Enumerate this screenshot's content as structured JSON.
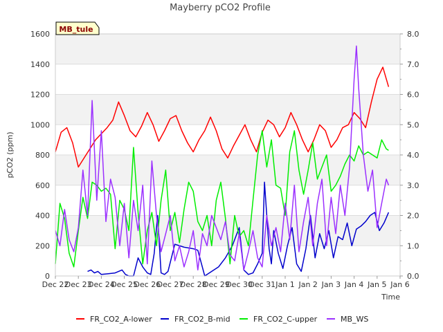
{
  "chart_data": {
    "type": "line",
    "title": "Mayberry pCO2 Profile",
    "xlabel": "Time",
    "ylabel": "pCO2 (ppm)",
    "y2label": "",
    "site_badge": "MB_tule",
    "xlim": [
      0,
      15
    ],
    "x_ticks": [
      "Dec 22",
      "Dec 23",
      "Dec 24",
      "Dec 25",
      "Dec 26",
      "Dec 27",
      "Dec 28",
      "Dec 29",
      "Dec 30",
      "Dec 31",
      "Jan 1",
      "Jan 2",
      "Jan 3",
      "Jan 4",
      "Jan 5",
      "Jan 6"
    ],
    "ylim": [
      0,
      1600
    ],
    "y_ticks": [
      0,
      200,
      400,
      600,
      800,
      1000,
      1200,
      1400,
      1600
    ],
    "y2lim": [
      0,
      8
    ],
    "y2_ticks": [
      "0.0",
      "1.0",
      "2.0",
      "3.0",
      "4.0",
      "5.0",
      "6.0",
      "7.0",
      "8.0"
    ],
    "background_bands": "alternating light grey every 200 ppm",
    "legend_position": "bottom",
    "series": [
      {
        "name": "FR_CO2_A-lower",
        "color": "#ff0000",
        "axis": "left",
        "x": [
          0.0,
          0.25,
          0.5,
          0.75,
          1.0,
          1.25,
          1.5,
          1.75,
          2.0,
          2.25,
          2.5,
          2.75,
          3.0,
          3.25,
          3.5,
          3.75,
          4.0,
          4.25,
          4.5,
          4.75,
          5.0,
          5.25,
          5.5,
          5.75,
          6.0,
          6.25,
          6.5,
          6.75,
          7.0,
          7.25,
          7.5,
          7.75,
          8.0,
          8.25,
          8.5,
          8.75,
          9.0,
          9.25,
          9.5,
          9.75,
          10.0,
          10.25,
          10.5,
          10.75,
          11.0,
          11.25,
          11.5,
          11.75,
          12.0,
          12.25,
          12.5,
          12.75,
          13.0,
          13.25,
          13.5,
          13.75,
          14.0,
          14.25,
          14.5
        ],
        "values": [
          820,
          950,
          980,
          880,
          720,
          780,
          840,
          900,
          940,
          980,
          1030,
          1150,
          1060,
          960,
          920,
          990,
          1080,
          1000,
          890,
          960,
          1040,
          1060,
          960,
          880,
          820,
          900,
          960,
          1050,
          960,
          840,
          780,
          860,
          930,
          1000,
          900,
          820,
          950,
          1030,
          1000,
          920,
          980,
          1080,
          1000,
          900,
          820,
          900,
          1000,
          960,
          850,
          900,
          980,
          1000,
          1080,
          1040,
          980,
          1150,
          1300,
          1380,
          1250
        ]
      },
      {
        "name": "FR_CO2_B-mid",
        "color": "#0000cc",
        "axis": "left",
        "x": [
          1.4,
          1.55,
          1.7,
          1.85,
          2.0,
          2.3,
          2.6,
          2.9,
          3.05,
          3.2,
          3.4,
          3.6,
          3.8,
          4.0,
          4.15,
          4.3,
          4.45,
          4.6,
          4.75,
          4.9,
          5.2,
          5.6,
          6.0,
          6.2,
          6.5,
          6.8,
          7.1,
          7.4,
          7.7,
          8.0,
          8.2,
          8.4,
          8.6,
          8.8,
          9.0,
          9.1,
          9.2,
          9.3,
          9.4,
          9.5,
          9.7,
          9.9,
          10.1,
          10.3,
          10.5,
          10.7,
          10.9,
          11.1,
          11.3,
          11.5,
          11.7,
          11.9,
          12.1,
          12.3,
          12.5,
          12.7,
          12.9,
          13.1,
          13.3,
          13.5,
          13.7,
          13.9,
          14.1,
          14.3,
          14.5
        ],
        "values": [
          30,
          40,
          20,
          30,
          10,
          15,
          20,
          40,
          10,
          0,
          0,
          120,
          60,
          20,
          10,
          150,
          400,
          20,
          10,
          30,
          210,
          190,
          180,
          170,
          0,
          30,
          60,
          120,
          200,
          320,
          40,
          10,
          20,
          80,
          150,
          620,
          400,
          180,
          80,
          300,
          150,
          50,
          200,
          320,
          80,
          30,
          180,
          400,
          120,
          280,
          180,
          300,
          120,
          260,
          240,
          350,
          200,
          310,
          330,
          360,
          400,
          420,
          300,
          350,
          420
        ]
      },
      {
        "name": "FR_CO2_C-upper",
        "color": "#00ee00",
        "axis": "left",
        "x": [
          0.0,
          0.2,
          0.4,
          0.6,
          0.8,
          1.0,
          1.2,
          1.4,
          1.6,
          1.8,
          2.0,
          2.2,
          2.4,
          2.6,
          2.8,
          3.0,
          3.2,
          3.4,
          3.6,
          3.8,
          4.0,
          4.2,
          4.4,
          4.6,
          4.8,
          5.0,
          5.2,
          5.4,
          5.6,
          5.8,
          6.0,
          6.2,
          6.4,
          6.6,
          6.8,
          7.0,
          7.2,
          7.4,
          7.6,
          7.8,
          8.0,
          8.2,
          8.4,
          8.6,
          8.8,
          9.0,
          9.2,
          9.4,
          9.6,
          9.8,
          10.0,
          10.2,
          10.4,
          10.6,
          10.8,
          11.0,
          11.2,
          11.4,
          11.6,
          11.8,
          12.0,
          12.2,
          12.4,
          12.6,
          12.8,
          13.0,
          13.2,
          13.4,
          13.6,
          13.8,
          14.0,
          14.2,
          14.4,
          14.5
        ],
        "values": [
          80,
          480,
          380,
          150,
          60,
          300,
          520,
          380,
          620,
          600,
          560,
          580,
          540,
          180,
          500,
          440,
          300,
          850,
          420,
          80,
          300,
          420,
          200,
          500,
          700,
          300,
          420,
          220,
          440,
          620,
          560,
          360,
          300,
          400,
          200,
          500,
          620,
          380,
          80,
          400,
          260,
          300,
          200,
          500,
          800,
          960,
          720,
          900,
          600,
          580,
          400,
          820,
          960,
          700,
          540,
          700,
          880,
          640,
          720,
          800,
          560,
          600,
          660,
          740,
          800,
          760,
          860,
          800,
          820,
          800,
          780,
          900,
          840,
          830
        ]
      },
      {
        "name": "MB_WS",
        "color": "#9b30ff",
        "axis": "right",
        "x": [
          0.0,
          0.2,
          0.4,
          0.6,
          0.8,
          1.0,
          1.2,
          1.4,
          1.6,
          1.8,
          2.0,
          2.2,
          2.4,
          2.6,
          2.8,
          3.0,
          3.2,
          3.4,
          3.6,
          3.8,
          4.0,
          4.2,
          4.4,
          4.6,
          4.8,
          5.0,
          5.2,
          5.4,
          5.6,
          5.8,
          6.0,
          6.2,
          6.4,
          6.6,
          6.8,
          7.0,
          7.2,
          7.4,
          7.6,
          7.8,
          8.0,
          8.2,
          8.4,
          8.6,
          8.8,
          9.0,
          9.2,
          9.4,
          9.6,
          9.8,
          10.0,
          10.2,
          10.4,
          10.6,
          10.8,
          11.0,
          11.2,
          11.4,
          11.6,
          11.8,
          12.0,
          12.2,
          12.4,
          12.6,
          12.8,
          13.0,
          13.1,
          13.2,
          13.4,
          13.6,
          13.8,
          14.0,
          14.2,
          14.4,
          14.5
        ],
        "values": [
          1.5,
          1.0,
          2.2,
          1.2,
          0.8,
          1.6,
          3.5,
          2.0,
          5.8,
          2.5,
          4.8,
          1.8,
          3.2,
          2.6,
          1.0,
          2.4,
          0.6,
          2.5,
          1.5,
          3.0,
          0.4,
          3.8,
          2.0,
          0.8,
          1.4,
          2.0,
          0.5,
          1.0,
          0.3,
          0.8,
          1.5,
          0.2,
          1.4,
          1.0,
          2.0,
          1.6,
          1.2,
          1.8,
          0.7,
          0.5,
          1.4,
          0.2,
          0.8,
          1.5,
          0.6,
          0.3,
          2.0,
          1.0,
          1.6,
          0.8,
          2.4,
          1.2,
          3.0,
          0.8,
          1.8,
          2.6,
          1.0,
          2.4,
          3.2,
          1.0,
          2.6,
          1.4,
          3.0,
          2.0,
          3.6,
          6.5,
          7.6,
          6.2,
          4.0,
          2.8,
          3.5,
          1.6,
          2.4,
          3.2,
          3.0
        ]
      }
    ]
  }
}
